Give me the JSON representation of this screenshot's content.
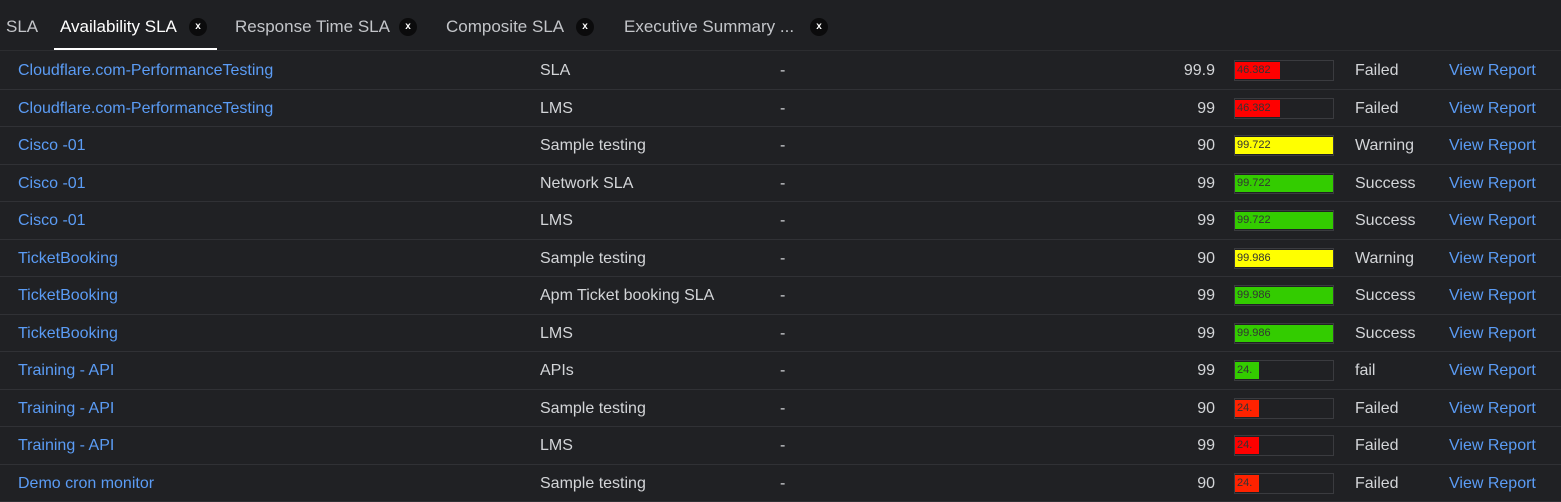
{
  "tabs": [
    {
      "label": "SLA",
      "active": false,
      "closable": false
    },
    {
      "label": "Availability SLA",
      "active": true,
      "closable": true
    },
    {
      "label": "Response Time SLA",
      "active": false,
      "closable": true
    },
    {
      "label": "Composite SLA",
      "active": false,
      "closable": true
    },
    {
      "label": "Executive Summary ...",
      "active": false,
      "closable": true
    }
  ],
  "close_glyph": "x",
  "colors": {
    "link": "#5b9cf5",
    "bar_red": "#ff0000",
    "bar_orange_red": "#ff2200",
    "bar_yellow": "#ffff00",
    "bar_green": "#33cc00",
    "background": "#202124"
  },
  "rows": [
    {
      "name": "Cloudflare.com-PerformanceTesting",
      "sla": "SLA",
      "dash": "-",
      "target": "99.9",
      "bar_value": "46.382",
      "bar_fraction": 0.46,
      "bar_color": "#ff0000",
      "status": "Failed",
      "link": "View Report"
    },
    {
      "name": "Cloudflare.com-PerformanceTesting",
      "sla": "LMS",
      "dash": "-",
      "target": "99",
      "bar_value": "46.382",
      "bar_fraction": 0.46,
      "bar_color": "#ff0000",
      "status": "Failed",
      "link": "View Report"
    },
    {
      "name": "Cisco -01",
      "sla": "Sample testing",
      "dash": "-",
      "target": "90",
      "bar_value": "99.722",
      "bar_fraction": 0.997,
      "bar_color": "#ffff00",
      "status": "Warning",
      "link": "View Report"
    },
    {
      "name": "Cisco -01",
      "sla": "Network SLA",
      "dash": "-",
      "target": "99",
      "bar_value": "99.722",
      "bar_fraction": 0.997,
      "bar_color": "#33cc00",
      "status": "Success",
      "link": "View Report"
    },
    {
      "name": "Cisco -01",
      "sla": "LMS",
      "dash": "-",
      "target": "99",
      "bar_value": "99.722",
      "bar_fraction": 0.997,
      "bar_color": "#33cc00",
      "status": "Success",
      "link": "View Report"
    },
    {
      "name": "TicketBooking",
      "sla": "Sample testing",
      "dash": "-",
      "target": "90",
      "bar_value": "99.986",
      "bar_fraction": 0.9999,
      "bar_color": "#ffff00",
      "status": "Warning",
      "link": "View Report"
    },
    {
      "name": "TicketBooking",
      "sla": "Apm Ticket booking SLA",
      "dash": "-",
      "target": "99",
      "bar_value": "99.986",
      "bar_fraction": 0.9999,
      "bar_color": "#33cc00",
      "status": "Success",
      "link": "View Report"
    },
    {
      "name": "TicketBooking",
      "sla": "LMS",
      "dash": "-",
      "target": "99",
      "bar_value": "99.986",
      "bar_fraction": 0.9999,
      "bar_color": "#33cc00",
      "status": "Success",
      "link": "View Report"
    },
    {
      "name": "Training - API",
      "sla": "APIs",
      "dash": "-",
      "target": "99",
      "bar_value": "24.",
      "bar_fraction": 0.24,
      "bar_color": "#33cc00",
      "status": "fail",
      "link": "View Report"
    },
    {
      "name": "Training - API",
      "sla": "Sample testing",
      "dash": "-",
      "target": "90",
      "bar_value": "24.",
      "bar_fraction": 0.24,
      "bar_color": "#ff2200",
      "status": "Failed",
      "link": "View Report"
    },
    {
      "name": "Training - API",
      "sla": "LMS",
      "dash": "-",
      "target": "99",
      "bar_value": "24.",
      "bar_fraction": 0.24,
      "bar_color": "#ff0000",
      "status": "Failed",
      "link": "View Report"
    },
    {
      "name": "Demo cron monitor",
      "sla": "Sample testing",
      "dash": "-",
      "target": "90",
      "bar_value": "24.",
      "bar_fraction": 0.24,
      "bar_color": "#ff2200",
      "status": "Failed",
      "link": "View Report"
    }
  ]
}
